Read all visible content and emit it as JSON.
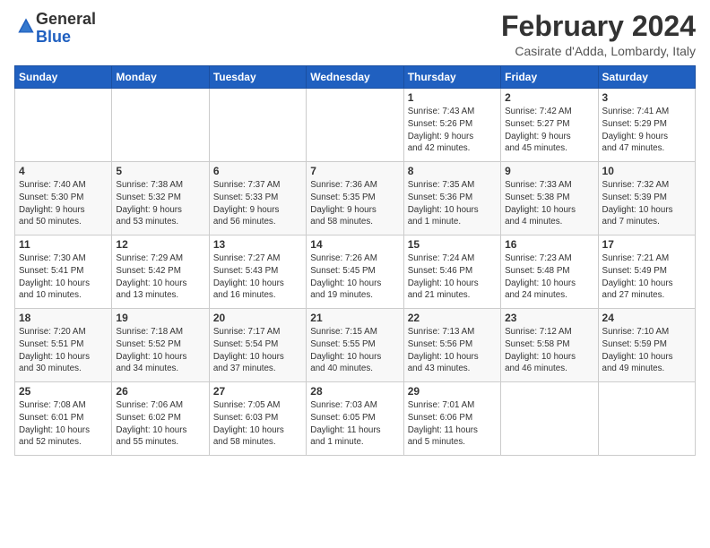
{
  "logo": {
    "general": "General",
    "blue": "Blue"
  },
  "title": "February 2024",
  "location": "Casirate d'Adda, Lombardy, Italy",
  "weekdays": [
    "Sunday",
    "Monday",
    "Tuesday",
    "Wednesday",
    "Thursday",
    "Friday",
    "Saturday"
  ],
  "weeks": [
    [
      {
        "day": "",
        "info": ""
      },
      {
        "day": "",
        "info": ""
      },
      {
        "day": "",
        "info": ""
      },
      {
        "day": "",
        "info": ""
      },
      {
        "day": "1",
        "info": "Sunrise: 7:43 AM\nSunset: 5:26 PM\nDaylight: 9 hours\nand 42 minutes."
      },
      {
        "day": "2",
        "info": "Sunrise: 7:42 AM\nSunset: 5:27 PM\nDaylight: 9 hours\nand 45 minutes."
      },
      {
        "day": "3",
        "info": "Sunrise: 7:41 AM\nSunset: 5:29 PM\nDaylight: 9 hours\nand 47 minutes."
      }
    ],
    [
      {
        "day": "4",
        "info": "Sunrise: 7:40 AM\nSunset: 5:30 PM\nDaylight: 9 hours\nand 50 minutes."
      },
      {
        "day": "5",
        "info": "Sunrise: 7:38 AM\nSunset: 5:32 PM\nDaylight: 9 hours\nand 53 minutes."
      },
      {
        "day": "6",
        "info": "Sunrise: 7:37 AM\nSunset: 5:33 PM\nDaylight: 9 hours\nand 56 minutes."
      },
      {
        "day": "7",
        "info": "Sunrise: 7:36 AM\nSunset: 5:35 PM\nDaylight: 9 hours\nand 58 minutes."
      },
      {
        "day": "8",
        "info": "Sunrise: 7:35 AM\nSunset: 5:36 PM\nDaylight: 10 hours\nand 1 minute."
      },
      {
        "day": "9",
        "info": "Sunrise: 7:33 AM\nSunset: 5:38 PM\nDaylight: 10 hours\nand 4 minutes."
      },
      {
        "day": "10",
        "info": "Sunrise: 7:32 AM\nSunset: 5:39 PM\nDaylight: 10 hours\nand 7 minutes."
      }
    ],
    [
      {
        "day": "11",
        "info": "Sunrise: 7:30 AM\nSunset: 5:41 PM\nDaylight: 10 hours\nand 10 minutes."
      },
      {
        "day": "12",
        "info": "Sunrise: 7:29 AM\nSunset: 5:42 PM\nDaylight: 10 hours\nand 13 minutes."
      },
      {
        "day": "13",
        "info": "Sunrise: 7:27 AM\nSunset: 5:43 PM\nDaylight: 10 hours\nand 16 minutes."
      },
      {
        "day": "14",
        "info": "Sunrise: 7:26 AM\nSunset: 5:45 PM\nDaylight: 10 hours\nand 19 minutes."
      },
      {
        "day": "15",
        "info": "Sunrise: 7:24 AM\nSunset: 5:46 PM\nDaylight: 10 hours\nand 21 minutes."
      },
      {
        "day": "16",
        "info": "Sunrise: 7:23 AM\nSunset: 5:48 PM\nDaylight: 10 hours\nand 24 minutes."
      },
      {
        "day": "17",
        "info": "Sunrise: 7:21 AM\nSunset: 5:49 PM\nDaylight: 10 hours\nand 27 minutes."
      }
    ],
    [
      {
        "day": "18",
        "info": "Sunrise: 7:20 AM\nSunset: 5:51 PM\nDaylight: 10 hours\nand 30 minutes."
      },
      {
        "day": "19",
        "info": "Sunrise: 7:18 AM\nSunset: 5:52 PM\nDaylight: 10 hours\nand 34 minutes."
      },
      {
        "day": "20",
        "info": "Sunrise: 7:17 AM\nSunset: 5:54 PM\nDaylight: 10 hours\nand 37 minutes."
      },
      {
        "day": "21",
        "info": "Sunrise: 7:15 AM\nSunset: 5:55 PM\nDaylight: 10 hours\nand 40 minutes."
      },
      {
        "day": "22",
        "info": "Sunrise: 7:13 AM\nSunset: 5:56 PM\nDaylight: 10 hours\nand 43 minutes."
      },
      {
        "day": "23",
        "info": "Sunrise: 7:12 AM\nSunset: 5:58 PM\nDaylight: 10 hours\nand 46 minutes."
      },
      {
        "day": "24",
        "info": "Sunrise: 7:10 AM\nSunset: 5:59 PM\nDaylight: 10 hours\nand 49 minutes."
      }
    ],
    [
      {
        "day": "25",
        "info": "Sunrise: 7:08 AM\nSunset: 6:01 PM\nDaylight: 10 hours\nand 52 minutes."
      },
      {
        "day": "26",
        "info": "Sunrise: 7:06 AM\nSunset: 6:02 PM\nDaylight: 10 hours\nand 55 minutes."
      },
      {
        "day": "27",
        "info": "Sunrise: 7:05 AM\nSunset: 6:03 PM\nDaylight: 10 hours\nand 58 minutes."
      },
      {
        "day": "28",
        "info": "Sunrise: 7:03 AM\nSunset: 6:05 PM\nDaylight: 11 hours\nand 1 minute."
      },
      {
        "day": "29",
        "info": "Sunrise: 7:01 AM\nSunset: 6:06 PM\nDaylight: 11 hours\nand 5 minutes."
      },
      {
        "day": "",
        "info": ""
      },
      {
        "day": "",
        "info": ""
      }
    ]
  ]
}
